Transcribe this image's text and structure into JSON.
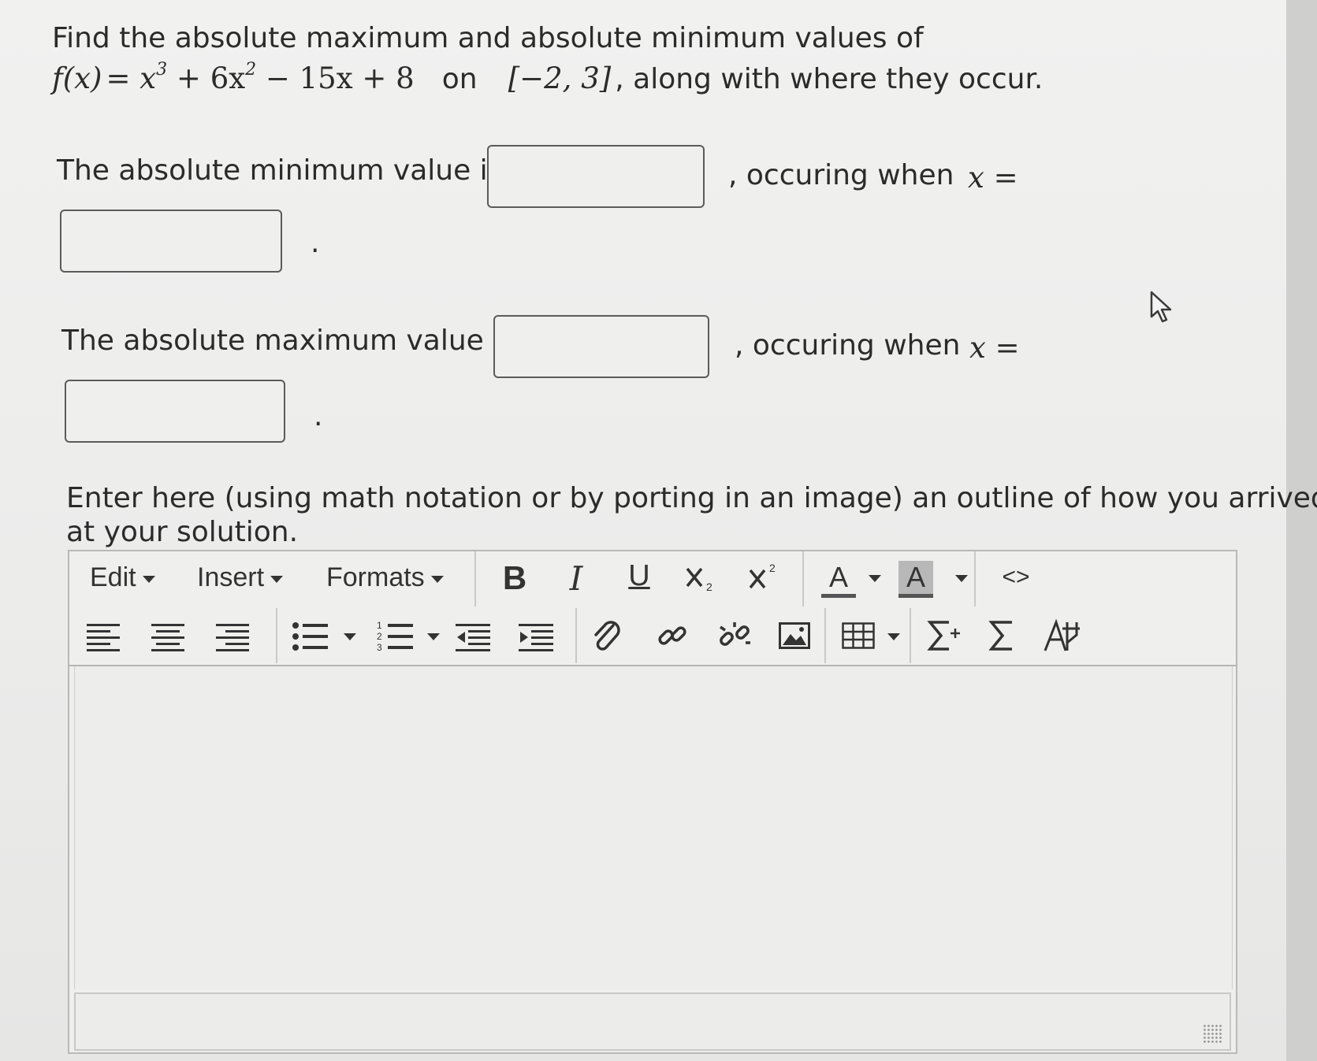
{
  "question": {
    "line1": "Find the absolute maximum and absolute minimum values of",
    "func_lhs": "f(x)",
    "func_rhs_parts": [
      "x",
      "3",
      " + 6x",
      "2",
      " − 15x + 8"
    ],
    "on": "on",
    "interval": "[−2, 3]",
    "tail": ", along with where they occur."
  },
  "min_row": {
    "label": "The absolute minimum value is",
    "occurring": ", occuring when",
    "x_eq": "x =",
    "value_input": "",
    "x_input": "",
    "period": "."
  },
  "max_row": {
    "label": "The absolute maximum value is",
    "occurring": ", occuring when",
    "x_eq": "x =",
    "value_input": "",
    "x_input": "",
    "period": "."
  },
  "instructions": {
    "line1": "Enter here (using math notation or by porting in an image) an outline of how you arrived",
    "line2": "at your solution."
  },
  "editor": {
    "menus": [
      "Edit",
      "Insert",
      "Formats"
    ],
    "bold": "B",
    "italic": "I",
    "underline": "U",
    "font_color_label": "A",
    "bg_color_label": "A",
    "code_label": "<>",
    "icons": [
      "bold-icon",
      "italic-icon",
      "underline-icon",
      "subscript-icon",
      "superscript-icon",
      "font-color-icon",
      "background-color-icon",
      "source-code-icon",
      "align-left-icon",
      "align-center-icon",
      "align-right-icon",
      "bullet-list-icon",
      "numbered-list-icon",
      "outdent-icon",
      "indent-icon",
      "attachment-icon",
      "link-icon",
      "unlink-icon",
      "image-icon",
      "table-icon",
      "insert-formula-icon",
      "sigma-icon",
      "special-char-icon"
    ],
    "content": ""
  },
  "colors": {
    "text": "#2b2b2b",
    "box_border": "#5b5b5b",
    "toolbar_border": "#b9b9b9"
  }
}
